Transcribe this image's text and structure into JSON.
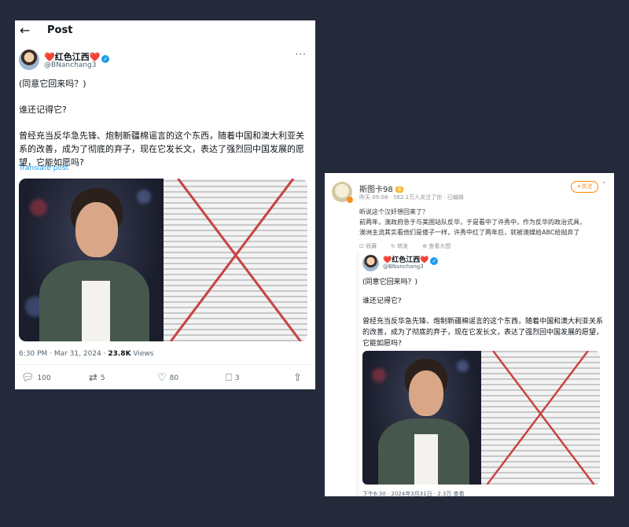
{
  "tweet": {
    "header": {
      "back_icon": "arrow-left-icon",
      "title": "Post"
    },
    "author": {
      "name": "❤️红色江西❤️",
      "handle": "@BNanchang3",
      "verified": true
    },
    "text": {
      "line1": "(同意它回来吗？)",
      "line2": "谁还记得它?",
      "line3": "曾经充当反华急先锋、炮制新疆棉谣言的这个东西，随着中国和澳大利亚关系的改善，成为了彻底的弃子，现在它发长文，表达了强烈回中国发展的愿望，它能如愿吗?"
    },
    "translate": "Translate post",
    "meta": {
      "time": "6:30 PM · Mar 31, 2024 · ",
      "views_count": "23.8K",
      "views_label": " Views"
    },
    "actions": {
      "replies": "100",
      "reposts": "5",
      "likes": "80",
      "bookmarks": "3"
    }
  },
  "weibo": {
    "author": {
      "name": "斯图卡98",
      "vip_label": "8"
    },
    "meta": "昨天 09:08 · 562.1万人关注了你 · 已编辑",
    "follow": "+关注",
    "text": {
      "line1": "听说这个汉奸想回来了？",
      "line2": "前两年，澳政府急于与美国站队反华，于是看中了许秀中，作为反华的政治式具，",
      "line3": "澳洲主流其实看他们是傻子一样，许秀中红了两年后，就被澳媒给ABC给抛弃了"
    },
    "actions": {
      "favorite": "收藏",
      "repost": "转发",
      "view_image": "查看大图"
    },
    "quote": {
      "name": "❤️红色江西❤️",
      "handle": "@BNanchang3",
      "line1": "(同意它回来吗？)",
      "line2": "谁还记得它?",
      "line3": "曾经充当反华急先锋、炮制新疆棉谣言的这个东西，随着中国和澳大利亚关系的改善，成为了彻底的弃子，现在它发长文，表达了强烈回中国发展的愿望，它能如愿吗?",
      "time": "下午6:30 · 2024年3月31日 · 2.3万 查看"
    }
  },
  "colors": {
    "background": "#252a3b",
    "x_blue": "#1d9bf0",
    "weibo_orange": "#ff8200",
    "cross_red": "#c94444"
  }
}
